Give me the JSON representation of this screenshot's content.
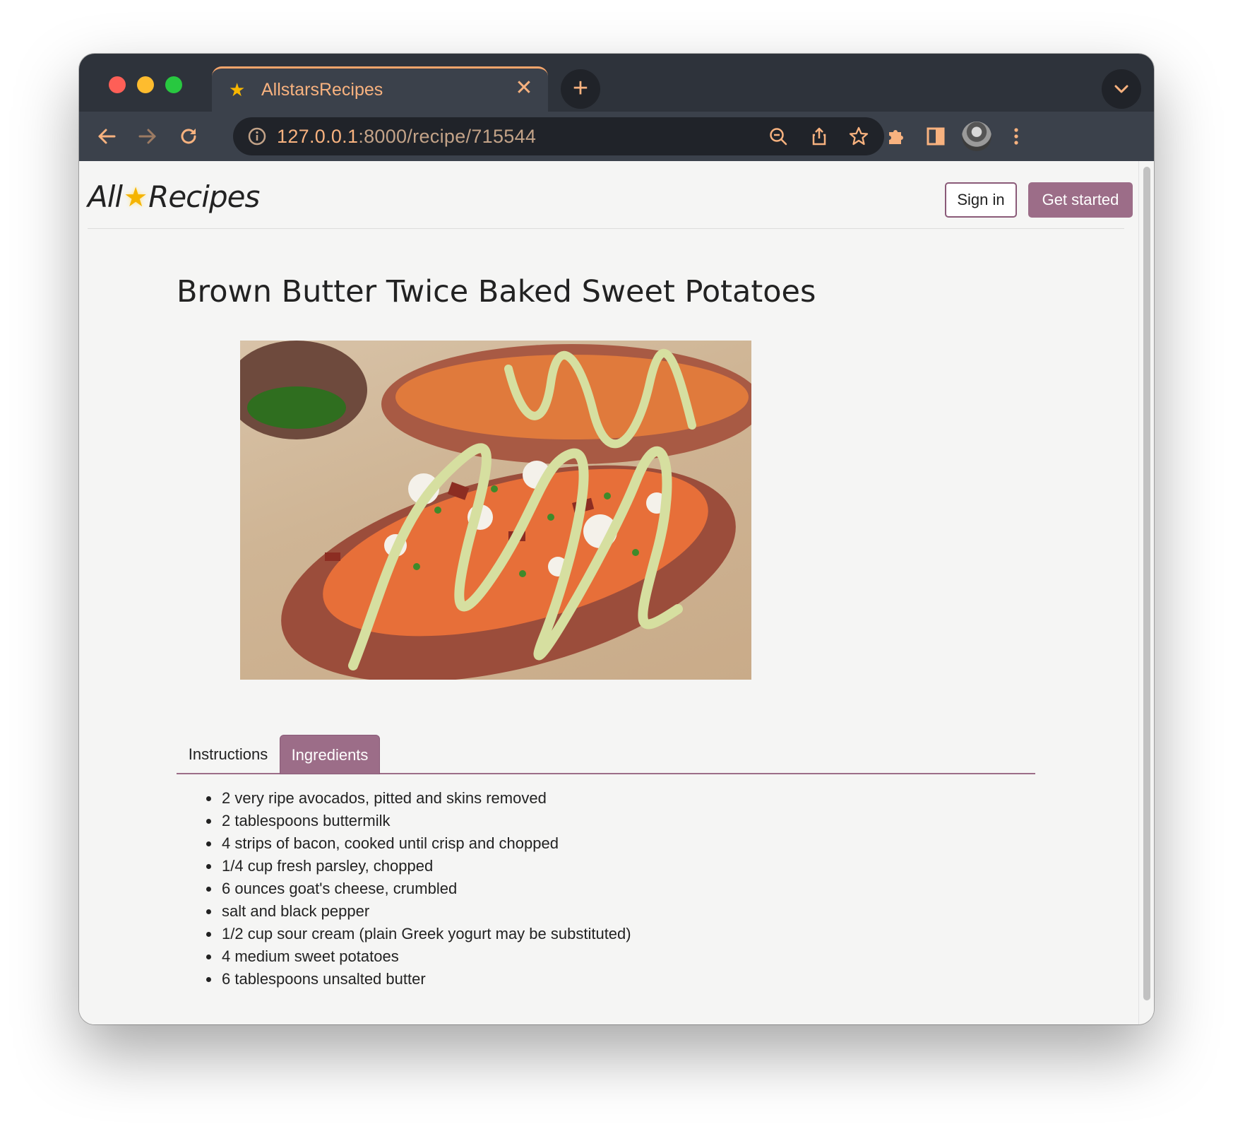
{
  "browser": {
    "tab_title": "AllstarsRecipes",
    "url_host": "127.0.0.1",
    "url_rest": ":8000/recipe/715544"
  },
  "header": {
    "logo_left": "All",
    "logo_right": "Recipes",
    "signin_label": "Sign in",
    "get_started_label": "Get started"
  },
  "recipe": {
    "title": "Brown Butter Twice Baked Sweet Potatoes"
  },
  "tabs": [
    {
      "label": "Instructions",
      "active": false
    },
    {
      "label": "Ingredients",
      "active": true
    }
  ],
  "ingredients": [
    "2 very ripe avocados, pitted and skins removed",
    "2 tablespoons buttermilk",
    "4 strips of bacon, cooked until crisp and chopped",
    "1/4 cup fresh parsley, chopped",
    "6 ounces goat's cheese, crumbled",
    "salt and black pepper",
    "1/2 cup sour cream (plain Greek yogurt may be substituted)",
    "4 medium sweet potatoes",
    "6 tablespoons unsalted butter"
  ],
  "colors": {
    "accent": "#9c6d88",
    "browser_orange": "#f8b27f"
  }
}
